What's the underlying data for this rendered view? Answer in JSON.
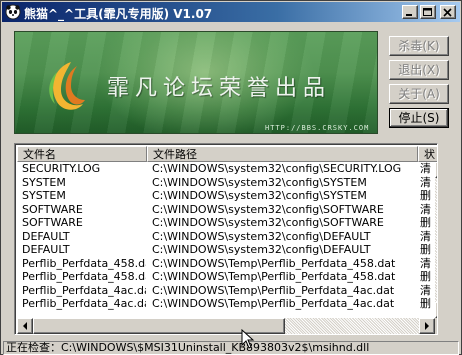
{
  "window": {
    "title": "熊猫^_^工具(霏凡专用版) V1.07"
  },
  "banner": {
    "text": "霏凡论坛荣誉出品",
    "url": "HTTP://BBS.CRSKY.COM"
  },
  "buttons": {
    "kill": "杀毒(K)",
    "exit": "退出(X)",
    "about": "关于(A)",
    "stop": "停止(S)"
  },
  "listview": {
    "columns": [
      "文件名",
      "文件路径",
      "状"
    ],
    "rows": [
      {
        "name": "SECURITY.LOG",
        "path": "C:\\WINDOWS\\system32\\config\\SECURITY.LOG",
        "status": "清"
      },
      {
        "name": "SYSTEM",
        "path": "C:\\WINDOWS\\system32\\config\\SYSTEM",
        "status": "清"
      },
      {
        "name": "SYSTEM",
        "path": "C:\\WINDOWS\\system32\\config\\SYSTEM",
        "status": "删"
      },
      {
        "name": "SOFTWARE",
        "path": "C:\\WINDOWS\\system32\\config\\SOFTWARE",
        "status": "清"
      },
      {
        "name": "SOFTWARE",
        "path": "C:\\WINDOWS\\system32\\config\\SOFTWARE",
        "status": "删"
      },
      {
        "name": "DEFAULT",
        "path": "C:\\WINDOWS\\system32\\config\\DEFAULT",
        "status": "清"
      },
      {
        "name": "DEFAULT",
        "path": "C:\\WINDOWS\\system32\\config\\DEFAULT",
        "status": "删"
      },
      {
        "name": "Perflib_Perfdata_458.dat",
        "path": "C:\\WINDOWS\\Temp\\Perflib_Perfdata_458.dat",
        "status": "清"
      },
      {
        "name": "Perflib_Perfdata_458.dat",
        "path": "C:\\WINDOWS\\Temp\\Perflib_Perfdata_458.dat",
        "status": "删"
      },
      {
        "name": "Perflib_Perfdata_4ac.dat",
        "path": "C:\\WINDOWS\\Temp\\Perflib_Perfdata_4ac.dat",
        "status": "清"
      },
      {
        "name": "Perflib_Perfdata_4ac.dat",
        "path": "C:\\WINDOWS\\Temp\\Perflib_Perfdata_4ac.dat",
        "status": "删"
      }
    ]
  },
  "statusbar": {
    "text": "正在检查：C:\\WINDOWS\\$MSI31Uninstall_KB893803v2$\\msihnd.dll"
  },
  "icons": {
    "app": "panda-icon",
    "minimize": "minimize-icon",
    "maximize": "maximize-icon",
    "close": "close-icon",
    "logo": "swirl-logo-icon"
  },
  "colors": {
    "titlebar_start": "#0a246a",
    "titlebar_end": "#a6caf0",
    "banner_green": "#3f8a45",
    "face": "#d4d0c8"
  }
}
